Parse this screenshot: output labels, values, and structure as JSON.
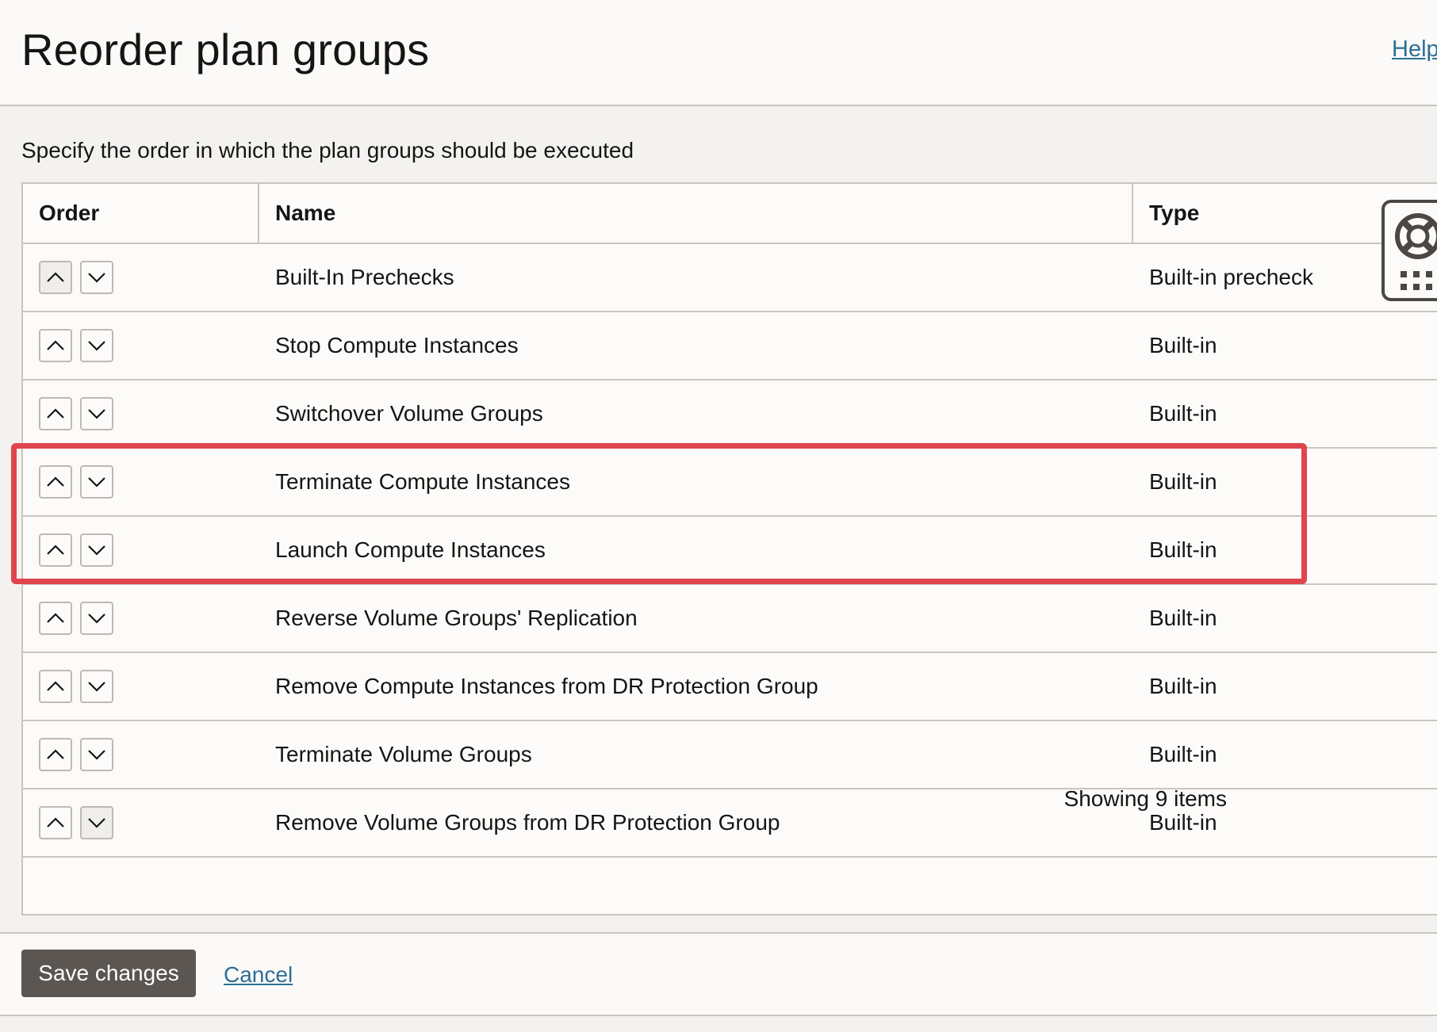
{
  "header": {
    "title": "Reorder plan groups",
    "help_link": "Help"
  },
  "description": "Specify the order in which the plan groups should be executed",
  "table": {
    "columns": {
      "order": "Order",
      "name": "Name",
      "type": "Type"
    },
    "rows": [
      {
        "name": "Built-In Prechecks",
        "type": "Built-in precheck",
        "up_enabled": false,
        "down_enabled": true
      },
      {
        "name": "Stop Compute Instances",
        "type": "Built-in",
        "up_enabled": true,
        "down_enabled": true
      },
      {
        "name": "Switchover Volume Groups",
        "type": "Built-in",
        "up_enabled": true,
        "down_enabled": true
      },
      {
        "name": "Terminate Compute Instances",
        "type": "Built-in",
        "up_enabled": true,
        "down_enabled": true
      },
      {
        "name": "Launch Compute Instances",
        "type": "Built-in",
        "up_enabled": true,
        "down_enabled": true
      },
      {
        "name": "Reverse Volume Groups' Replication",
        "type": "Built-in",
        "up_enabled": true,
        "down_enabled": true
      },
      {
        "name": "Remove Compute Instances from DR Protection Group",
        "type": "Built-in",
        "up_enabled": true,
        "down_enabled": true
      },
      {
        "name": "Terminate Volume Groups",
        "type": "Built-in",
        "up_enabled": true,
        "down_enabled": true
      },
      {
        "name": "Remove Volume Groups from DR Protection Group",
        "type": "Built-in",
        "up_enabled": true,
        "down_enabled": false
      }
    ],
    "footer_count": "Showing 9 items"
  },
  "highlighted_rows": [
    "Terminate Compute Instances",
    "Launch Compute Instances"
  ],
  "footer": {
    "save_label": "Save changes",
    "cancel_label": "Cancel"
  },
  "icons": {
    "move_up": "chevron-up-icon",
    "move_down": "chevron-down-icon",
    "helper": "lifebuoy-icon",
    "apps": "grid-icon"
  },
  "colors": {
    "highlight_border": "#e0454d",
    "primary_button": "#5b5652",
    "link": "#2c6f96"
  }
}
